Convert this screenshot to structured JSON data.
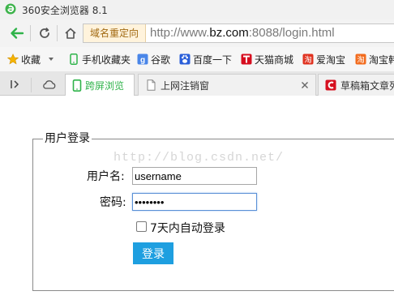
{
  "window": {
    "title": "360安全浏览器 8.1"
  },
  "address_bar": {
    "redirect_badge": "域名重定向",
    "url_prefix": "http://www.",
    "url_domain": "bz.com",
    "url_suffix": ":8088/login.html"
  },
  "bookmarks": {
    "favorites_label": "收藏",
    "items": [
      {
        "label": "手机收藏夹",
        "icon": "phone-icon"
      },
      {
        "label": "谷歌",
        "icon": "google-icon"
      },
      {
        "label": "百度一下",
        "icon": "baidu-icon"
      },
      {
        "label": "天猫商城",
        "icon": "tmall-icon"
      },
      {
        "label": "爱淘宝",
        "icon": "aitaobao-icon"
      },
      {
        "label": "淘宝韩",
        "icon": "taobao-icon"
      }
    ]
  },
  "tabs": [
    {
      "label": "跨屏浏览",
      "active": true
    },
    {
      "label": "上网注销窗",
      "active": false
    },
    {
      "label": "草稿箱文章列",
      "active": false
    }
  ],
  "form": {
    "legend": "用户登录",
    "watermark": "http://blog.csdn.net/",
    "username_label": "用户名:",
    "username_value": "username",
    "password_label": "密码:",
    "password_value": "password",
    "remember_label": "7天内自动登录",
    "remember_checked": false,
    "submit_label": "登录"
  },
  "colors": {
    "accent_green": "#2fb34a",
    "redirect_bg": "#fff3dc",
    "login_button": "#1e9fe0"
  }
}
